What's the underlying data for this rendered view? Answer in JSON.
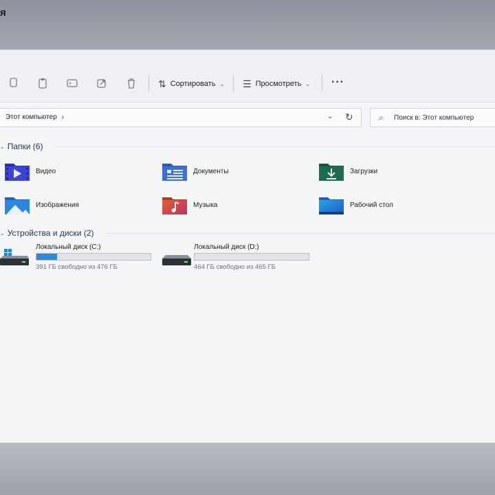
{
  "window": {
    "title_fragment": "я"
  },
  "toolbar": {
    "icons": [
      "copy-icon",
      "paste-icon",
      "rename-icon",
      "share-icon",
      "delete-icon"
    ],
    "sort_label": "Сортировать",
    "view_label": "Просмотреть",
    "more_label": "···"
  },
  "address": {
    "path": "Этот компьютер",
    "chevron": "›",
    "search_placeholder": "Поиск в: Этот компьютер"
  },
  "folders": {
    "header": "Папки (6)",
    "items": [
      {
        "label": "Видео",
        "icon": "videos-folder-icon"
      },
      {
        "label": "Документы",
        "icon": "documents-folder-icon"
      },
      {
        "label": "Загрузки",
        "icon": "downloads-folder-icon"
      },
      {
        "label": "Изображения",
        "icon": "pictures-folder-icon"
      },
      {
        "label": "Музыка",
        "icon": "music-folder-icon"
      },
      {
        "label": "Рабочий стол",
        "icon": "desktop-folder-icon"
      }
    ]
  },
  "drives": {
    "header": "Устройства и диски (2)",
    "items": [
      {
        "name": "Локальный диск (C:)",
        "free_text": "391 ГБ свободно из 476 ГБ",
        "used_fraction": 0.18
      },
      {
        "name": "Локальный диск (D:)",
        "free_text": "464 ГБ свободно из 465 ГБ",
        "used_fraction": 0.0
      }
    ]
  },
  "colors": {
    "accent": "#2f8ad8",
    "header_text": "#1f3550"
  }
}
